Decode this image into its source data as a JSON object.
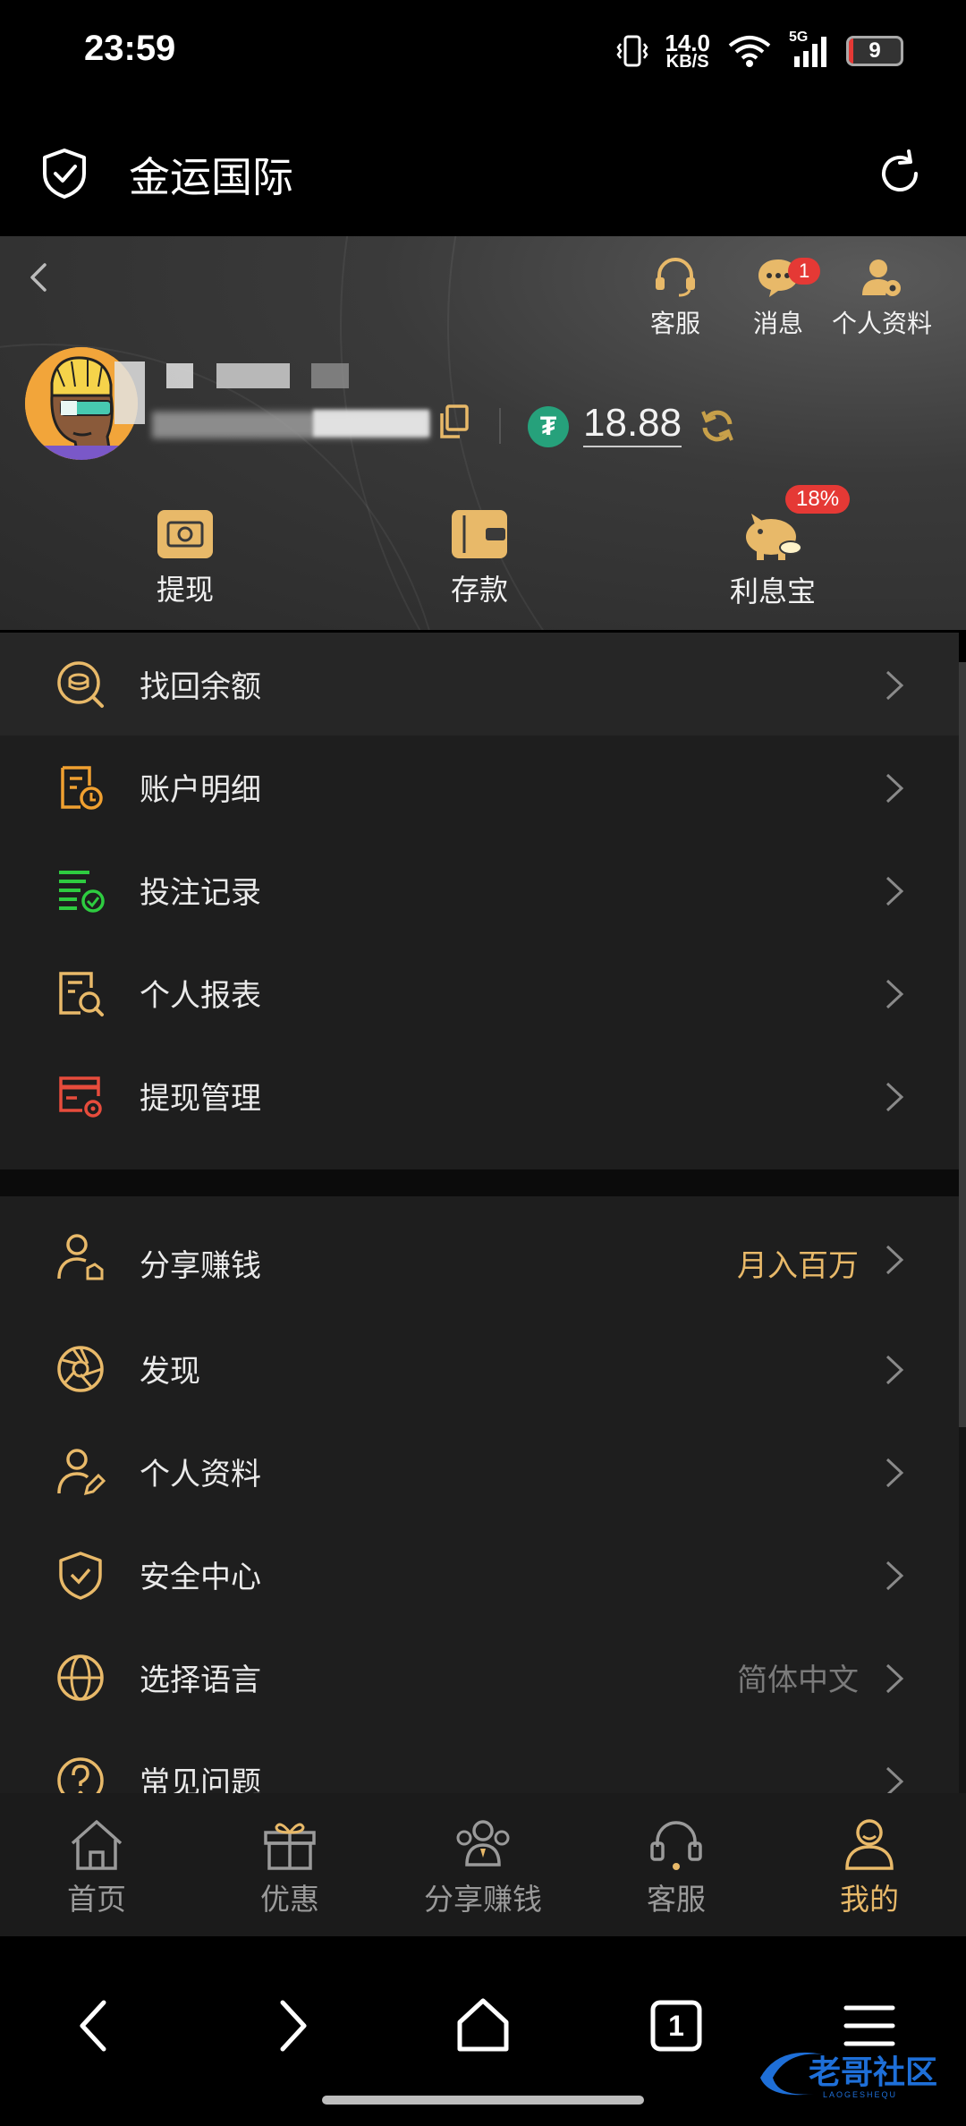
{
  "status_bar": {
    "time": "23:59",
    "net_speed": "14.0",
    "net_unit": "KB/S",
    "signal": "5G",
    "battery": "9",
    "battery_level": 0.09
  },
  "app_bar": {
    "title": "金运国际"
  },
  "header": {
    "top_actions": [
      {
        "label": "客服",
        "icon": "headset-icon"
      },
      {
        "label": "消息",
        "icon": "chat-bubble-icon",
        "badge": "1"
      },
      {
        "label": "个人资料",
        "icon": "user-gear-icon"
      }
    ],
    "balance": "18.88",
    "currency_icon": "usdt-icon",
    "quick_actions": [
      {
        "label": "提现",
        "icon": "withdraw-icon"
      },
      {
        "label": "存款",
        "icon": "wallet-icon"
      },
      {
        "label": "利息宝",
        "icon": "piggy-bank-icon",
        "badge": "18%"
      }
    ]
  },
  "menu_group1": [
    {
      "label": "找回余额",
      "icon": "coin-search-icon"
    },
    {
      "label": "账户明细",
      "icon": "account-detail-icon"
    },
    {
      "label": "投注记录",
      "icon": "bet-record-icon"
    },
    {
      "label": "个人报表",
      "icon": "report-search-icon"
    },
    {
      "label": "提现管理",
      "icon": "withdraw-manage-icon"
    }
  ],
  "menu_group2": [
    {
      "label": "分享赚钱",
      "icon": "share-user-icon",
      "extra": "月入百万"
    },
    {
      "label": "发现",
      "icon": "aperture-icon"
    },
    {
      "label": "个人资料",
      "icon": "user-edit-icon"
    },
    {
      "label": "安全中心",
      "icon": "shield-check-icon"
    },
    {
      "label": "选择语言",
      "icon": "globe-icon",
      "extra": "简体中文"
    },
    {
      "label": "常见问题",
      "icon": "question-icon"
    }
  ],
  "bottom_nav": [
    {
      "label": "首页",
      "icon": "home-icon"
    },
    {
      "label": "优惠",
      "icon": "gift-icon"
    },
    {
      "label": "分享赚钱",
      "icon": "group-icon"
    },
    {
      "label": "客服",
      "icon": "headset-icon"
    },
    {
      "label": "我的",
      "icon": "person-icon",
      "active": true
    }
  ],
  "system_nav": {
    "tab_count": "1"
  },
  "colors": {
    "gold": "#e8b969",
    "accent_green": "#2ecc40",
    "accent_red": "#e74c3c",
    "badge_red": "#e53935",
    "usdt_green": "#26a17b"
  },
  "watermark": "老哥社区"
}
